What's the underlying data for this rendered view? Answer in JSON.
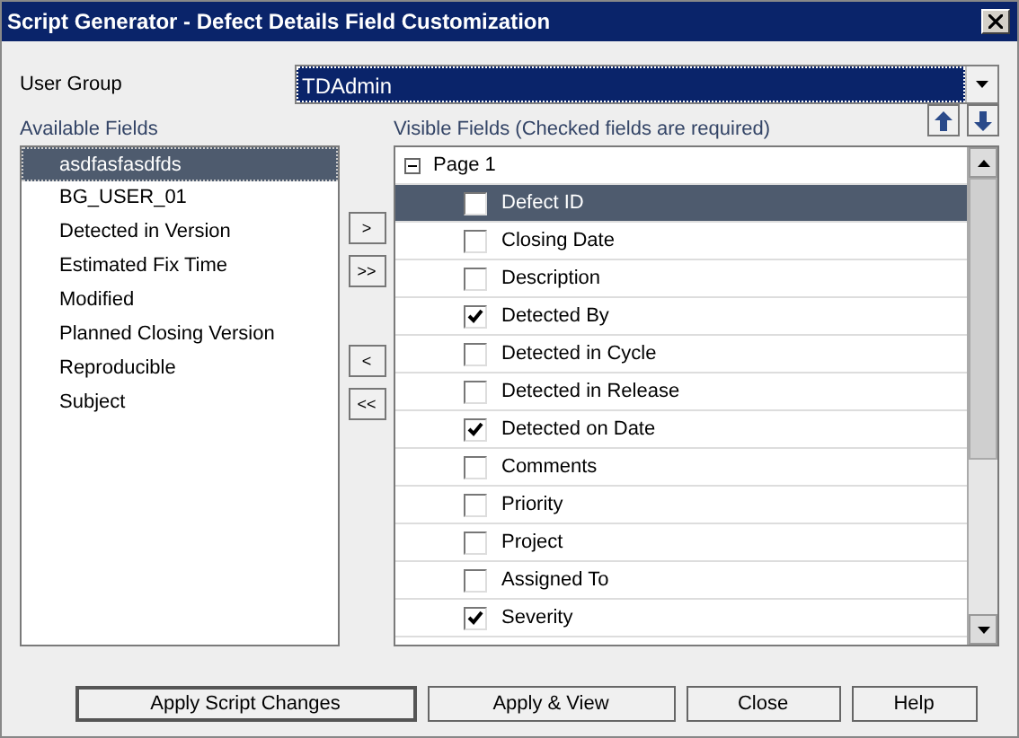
{
  "window": {
    "title": "Script Generator - Defect Details Field Customization"
  },
  "user_group": {
    "label": "User Group",
    "value": "TDAdmin"
  },
  "available_fields": {
    "label": "Available Fields",
    "items": [
      {
        "label": "asdfasfasdfds",
        "selected": true
      },
      {
        "label": "BG_USER_01",
        "selected": false
      },
      {
        "label": "Detected in Version",
        "selected": false
      },
      {
        "label": "Estimated Fix Time",
        "selected": false
      },
      {
        "label": "Modified",
        "selected": false
      },
      {
        "label": "Planned Closing Version",
        "selected": false
      },
      {
        "label": "Reproducible",
        "selected": false
      },
      {
        "label": "Subject",
        "selected": false
      }
    ]
  },
  "move_buttons": [
    ">",
    ">>",
    "<",
    "<<"
  ],
  "visible_fields": {
    "label": "Visible Fields (Checked fields are required)",
    "page": {
      "label": "Page 1",
      "expanded": true
    },
    "items": [
      {
        "label": "Defect ID",
        "checked": false,
        "selected": true
      },
      {
        "label": "Closing Date",
        "checked": false,
        "selected": false
      },
      {
        "label": "Description",
        "checked": false,
        "selected": false
      },
      {
        "label": "Detected By",
        "checked": true,
        "selected": false
      },
      {
        "label": "Detected in Cycle",
        "checked": false,
        "selected": false
      },
      {
        "label": "Detected in Release",
        "checked": false,
        "selected": false
      },
      {
        "label": "Detected on Date",
        "checked": true,
        "selected": false
      },
      {
        "label": "Comments",
        "checked": false,
        "selected": false
      },
      {
        "label": "Priority",
        "checked": false,
        "selected": false
      },
      {
        "label": "Project",
        "checked": false,
        "selected": false
      },
      {
        "label": "Assigned To",
        "checked": false,
        "selected": false
      },
      {
        "label": "Severity",
        "checked": true,
        "selected": false
      }
    ]
  },
  "buttons": [
    {
      "label": "Apply Script Changes",
      "default": true
    },
    {
      "label": "Apply & View",
      "default": false
    },
    {
      "label": "Close",
      "default": false
    },
    {
      "label": "Help",
      "default": false
    }
  ]
}
